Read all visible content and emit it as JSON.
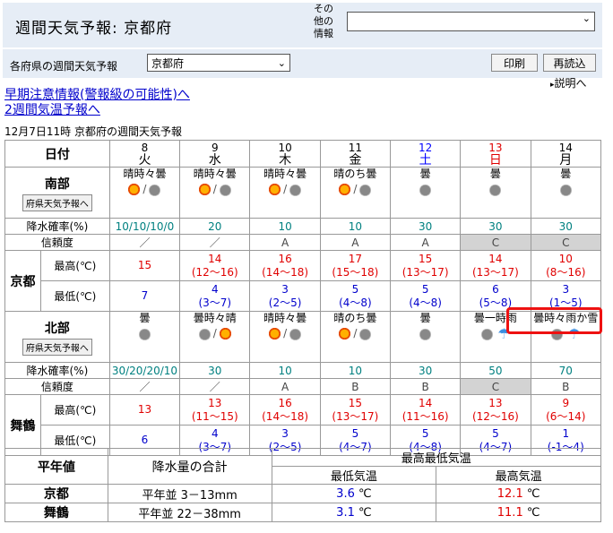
{
  "header": {
    "title": "週間天気予報: 京都府",
    "other_label": "その\n他の\n情報",
    "other_value": ""
  },
  "toolbar": {
    "pref_label": "各府県の週間天気予報",
    "pref_value": "京都府",
    "print": "印刷",
    "reload": "再読込",
    "explain": "説明へ"
  },
  "links": {
    "early": "早期注意情報(警報級の可能性)へ",
    "two_week": "2週間気温予報へ"
  },
  "caption": "12月7日11時 京都府の週間天気予報",
  "days": [
    {
      "d": "8",
      "w": "火",
      "cls": ""
    },
    {
      "d": "9",
      "w": "水",
      "cls": ""
    },
    {
      "d": "10",
      "w": "木",
      "cls": ""
    },
    {
      "d": "11",
      "w": "金",
      "cls": ""
    },
    {
      "d": "12",
      "w": "土",
      "cls": "sat"
    },
    {
      "d": "13",
      "w": "日",
      "cls": "sun"
    },
    {
      "d": "14",
      "w": "月",
      "cls": ""
    }
  ],
  "labels": {
    "date": "日付",
    "south": "南部",
    "north": "北部",
    "pref_btn": "府県天気予報へ",
    "pop": "降水確率(%)",
    "rel": "信頼度",
    "kyoto": "京都",
    "maizuru": "舞鶴",
    "max": "最高(℃)",
    "min": "最低(℃)"
  },
  "south": {
    "weather": [
      "晴時々曇",
      "晴時々曇",
      "晴時々曇",
      "晴のち曇",
      "曇",
      "曇",
      "曇"
    ],
    "icons": [
      [
        "sun",
        "cloud"
      ],
      [
        "sun",
        "cloud"
      ],
      [
        "sun",
        "cloud"
      ],
      [
        "sun",
        "cloud"
      ],
      [
        "cloud"
      ],
      [
        "cloud"
      ],
      [
        "cloud"
      ]
    ],
    "pop": [
      "10/10/10/0",
      "20",
      "10",
      "10",
      "30",
      "30",
      "30"
    ],
    "rel": [
      "／",
      "／",
      "A",
      "A",
      "A",
      "C",
      "C"
    ],
    "max": [
      [
        "15",
        ""
      ],
      [
        "14",
        "(12～16)"
      ],
      [
        "16",
        "(14～18)"
      ],
      [
        "17",
        "(15～18)"
      ],
      [
        "15",
        "(13～17)"
      ],
      [
        "14",
        "(13～17)"
      ],
      [
        "10",
        "(8～16)"
      ]
    ],
    "min": [
      [
        "7",
        ""
      ],
      [
        "4",
        "(3～7)"
      ],
      [
        "3",
        "(2～5)"
      ],
      [
        "5",
        "(4～8)"
      ],
      [
        "5",
        "(4～8)"
      ],
      [
        "6",
        "(5～8)"
      ],
      [
        "3",
        "(1～5)"
      ]
    ]
  },
  "north": {
    "weather": [
      "曇",
      "曇時々晴",
      "晴時々曇",
      "晴のち曇",
      "曇",
      "曇一時雨",
      "曇時々雨か雪"
    ],
    "icons": [
      [
        "cloud"
      ],
      [
        "cloud",
        "sun"
      ],
      [
        "sun",
        "cloud"
      ],
      [
        "sun",
        "cloud"
      ],
      [
        "cloud"
      ],
      [
        "cloud",
        "umb"
      ],
      [
        "cloud",
        "umb"
      ]
    ],
    "pop": [
      "30/20/20/10",
      "30",
      "10",
      "10",
      "30",
      "50",
      "70"
    ],
    "rel": [
      "／",
      "／",
      "A",
      "B",
      "B",
      "C",
      "B"
    ],
    "max": [
      [
        "13",
        ""
      ],
      [
        "13",
        "(11～15)"
      ],
      [
        "16",
        "(14～18)"
      ],
      [
        "15",
        "(13～17)"
      ],
      [
        "14",
        "(11～16)"
      ],
      [
        "13",
        "(12～16)"
      ],
      [
        "9",
        "(6～14)"
      ]
    ],
    "min": [
      [
        "6",
        ""
      ],
      [
        "4",
        "(3～7)"
      ],
      [
        "3",
        "(2～5)"
      ],
      [
        "5",
        "(4～7)"
      ],
      [
        "5",
        "(4～8)"
      ],
      [
        "5",
        "(4～7)"
      ],
      [
        "1",
        "(-1～4)"
      ]
    ]
  },
  "normals": {
    "head": "平年値",
    "precip": "降水量の合計",
    "temps": "最高最低気温",
    "min": "最低気温",
    "max": "最高気温",
    "rows": [
      {
        "name": "京都",
        "precip": "平年並 3－13mm",
        "min": "3.6",
        "max": "12.1"
      },
      {
        "name": "舞鶴",
        "precip": "平年並 22－38mm",
        "min": "3.1",
        "max": "11.1"
      }
    ],
    "unit": "℃"
  },
  "colors": {
    "highlight": "#ee1111",
    "header_bg": "#e6edf6"
  }
}
